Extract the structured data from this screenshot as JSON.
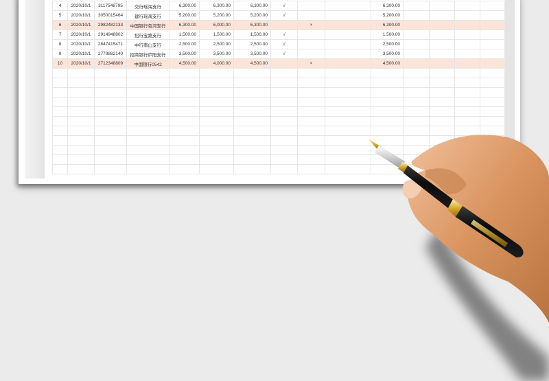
{
  "sheet": {
    "rows": [
      {
        "no": "4",
        "date": "2020/10/1",
        "account": "3117548795",
        "bank": "交行瑶海支行",
        "amt1": "6,300.00",
        "amt2": "6,300.00",
        "amt3": "6,300.00",
        "check": "√",
        "cross": "",
        "note": "",
        "amt4": "6,300.00",
        "highlight": false
      },
      {
        "no": "5",
        "date": "2020/10/1",
        "account": "3050015464",
        "bank": "建行瑶海支行",
        "amt1": "5,200.00",
        "amt2": "5,200.00",
        "amt3": "5,200.00",
        "check": "√",
        "cross": "",
        "note": "",
        "amt4": "5,200.00",
        "highlight": false
      },
      {
        "no": "6",
        "date": "2020/10/1",
        "account": "2982482133",
        "bank": "中国银行包河支行",
        "amt1": "6,300.00",
        "amt2": "6,000.00",
        "amt3": "6,300.00",
        "check": "",
        "cross": "×",
        "note": "",
        "amt4": "6,300.00",
        "highlight": true
      },
      {
        "no": "7",
        "date": "2020/10/1",
        "account": "2914948802",
        "bank": "招行宝路支行",
        "amt1": "1,500.00",
        "amt2": "1,500.00",
        "amt3": "1,500.00",
        "check": "√",
        "cross": "",
        "note": "",
        "amt4": "1,500.00",
        "highlight": false
      },
      {
        "no": "8",
        "date": "2020/10/1",
        "account": "2847415471",
        "bank": "中行南山支行",
        "amt1": "2,500.00",
        "amt2": "2,500.00",
        "amt3": "2,500.00",
        "check": "√",
        "cross": "",
        "note": "",
        "amt4": "2,500.00",
        "highlight": false
      },
      {
        "no": "9",
        "date": "2020/10/1",
        "account": "2779882140",
        "bank": "招商银行庐阳支行",
        "amt1": "3,500.00",
        "amt2": "3,500.00",
        "amt3": "3,500.00",
        "check": "√",
        "cross": "",
        "note": "",
        "amt4": "3,500.00",
        "highlight": false
      },
      {
        "no": "10",
        "date": "2020/10/1",
        "account": "2712348809",
        "bank": "中国银行0542",
        "amt1": "4,500.00",
        "amt2": "4,000.00",
        "amt3": "4,500.00",
        "check": "",
        "cross": "×",
        "note": "",
        "amt4": "4,500.00",
        "highlight": true
      }
    ],
    "empty_rows": 11,
    "highlight_color": "#fce4d8"
  },
  "decor": {
    "hand_icon": "hand-holding-fountain-pen"
  }
}
